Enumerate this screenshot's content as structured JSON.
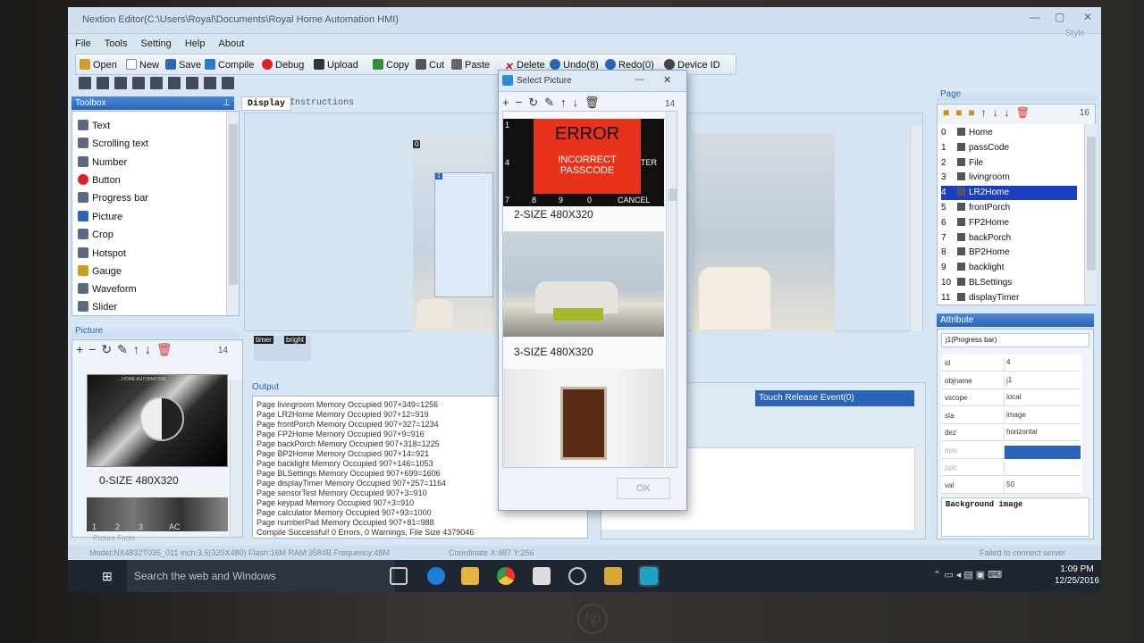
{
  "window": {
    "title": "Nextion Editor(C:\\Users\\Royal\\Documents\\Royal Home Automation HMI)",
    "skin": "Style"
  },
  "menu": [
    "File",
    "Tools",
    "Setting",
    "Help",
    "About"
  ],
  "toolbar": {
    "open": "Open",
    "new": "New",
    "save": "Save",
    "compile": "Compile",
    "debug": "Debug",
    "upload": "Upload",
    "copy": "Copy",
    "cut": "Cut",
    "paste": "Paste",
    "delete": "Delete",
    "undo": "Undo(8)",
    "redo": "Redo(0)",
    "device_id": "Device  ID"
  },
  "toolbox": {
    "title": "Toolbox",
    "items": [
      "Text",
      "Scrolling text",
      "Number",
      "Button",
      "Progress bar",
      "Picture",
      "Crop",
      "Hotspot",
      "Gauge",
      "Waveform",
      "Slider"
    ]
  },
  "picture_panel": {
    "title": "Picture",
    "count": "14",
    "caption": "0-SIZE 480X320",
    "thumb_text": "...HOME AUTOMATION",
    "keys": [
      "1",
      "2",
      "3",
      "AC"
    ],
    "tabs": [
      "Picture",
      "Fonts"
    ]
  },
  "editor_tabs": [
    "Display",
    "Instructions"
  ],
  "canvas": {
    "page_marker": "0",
    "comp_marker": "1",
    "labels": [
      "timer",
      "bright"
    ]
  },
  "output": {
    "title": "Output",
    "lines": [
      "Page livingroom Memory Occupied 907+349=1256",
      "Page LR2Home Memory Occupied 907+12=919",
      "Page frontPorch Memory Occupied 907+327=1234",
      "Page FP2Home Memory Occupied 907+9=916",
      "Page backPorch Memory Occupied 907+318=1225",
      "Page BP2Home Memory Occupied 907+14=921",
      "Page backlight Memory Occupied 907+146=1053",
      "Page BLSettings Memory Occupied 907+699=1606",
      "Page displayTimer Memory Occupied 907+257=1164",
      "Page sensorTest Memory Occupied 907+3=910",
      "Page keypad Memory Occupied 907+3=910",
      "Page calculator Memory Occupied 907+93=1000",
      "Page numberPad Memory Occupied 907+81=988",
      "Compile Successful! 0 Errors, 0 Warnings, File Size 4379046"
    ]
  },
  "dialog": {
    "title": "Select Picture",
    "count": "14",
    "error_img": {
      "heading": "ERROR",
      "sub1": "INCORRECT",
      "sub2": "PASSCODE",
      "cancel": "CANCEL",
      "keys": [
        "1",
        "4",
        "7",
        "8",
        "9",
        "0",
        "TER"
      ]
    },
    "captions": [
      "2-SIZE 480X320",
      "3-SIZE 480X320"
    ],
    "ok": "OK"
  },
  "events": {
    "active": "Touch Release Event(0)"
  },
  "pages": {
    "title": "Page",
    "count": "16",
    "items": [
      {
        "id": "0",
        "name": "Home"
      },
      {
        "id": "1",
        "name": "passCode"
      },
      {
        "id": "2",
        "name": "File"
      },
      {
        "id": "3",
        "name": "livingroom"
      },
      {
        "id": "4",
        "name": "LR2Home"
      },
      {
        "id": "5",
        "name": "frontPorch"
      },
      {
        "id": "6",
        "name": "FP2Home"
      },
      {
        "id": "7",
        "name": "backPorch"
      },
      {
        "id": "8",
        "name": "BP2Home"
      },
      {
        "id": "9",
        "name": "backlight"
      },
      {
        "id": "10",
        "name": "BLSettings"
      },
      {
        "id": "11",
        "name": "displayTimer"
      }
    ],
    "selected": 4
  },
  "attribute": {
    "title": "Attribute",
    "object": "j1(Progress bar)",
    "rows": [
      {
        "k": "id",
        "v": "4"
      },
      {
        "k": "objname",
        "v": "j1"
      },
      {
        "k": "vscope",
        "v": "local"
      },
      {
        "k": "sta",
        "v": "image"
      },
      {
        "k": "dez",
        "v": "horizontal"
      },
      {
        "k": "bpic",
        "v": ""
      },
      {
        "k": "ppic",
        "v": ""
      },
      {
        "k": "val",
        "v": "50"
      }
    ],
    "desc": "Background image"
  },
  "status": {
    "model": "Model:NX4832T035_011  inch:3.5(320X480) Flash:16M RAM:3584B Frequency:48M",
    "coord": "Coordinate X:487  Y:256",
    "conn": "Failed to connect server"
  },
  "taskbar": {
    "search": "Search the web and Windows",
    "time": "1:09 PM",
    "date": "12/25/2016"
  },
  "colors": {
    "accent": "#2a64b8",
    "selection": "#1b3fc0",
    "error_red": "#e8321c",
    "taskbar": "#1e2632"
  }
}
